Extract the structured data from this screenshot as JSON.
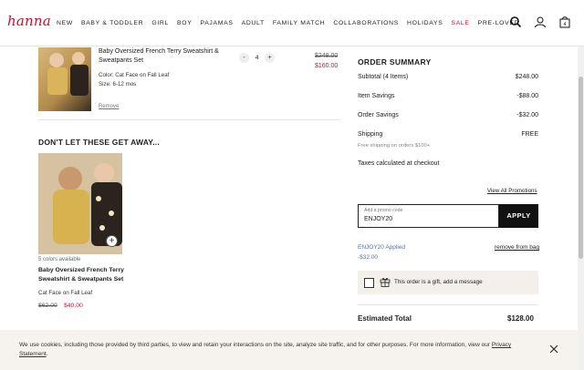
{
  "header": {
    "logo": "hanna",
    "nav": [
      "NEW",
      "BABY & TODDLER",
      "GIRL",
      "BOY",
      "PAJAMAS",
      "ADULT",
      "FAMILY MATCH",
      "COLLABORATIONS",
      "HOLIDAYS",
      "SALE",
      "PRE-LOVED"
    ],
    "cart_count": "4"
  },
  "cart_item": {
    "title": "Baby Oversized French Terry Sweatshirt & Sweatpants Set",
    "color": "Color: Cat Face on Fall Leaf",
    "size": "Size: 6-12 mos",
    "remove_label": "Remove",
    "qty_minus": "-",
    "quantity": "4",
    "qty_plus": "+",
    "old_price": "$248.00",
    "new_price": "$160.00"
  },
  "recommendations": {
    "title": "DON'T LET THESE GET AWAY...",
    "colors": "5 colors available",
    "name": "Baby Oversized French Terry Sweatshirt & Sweatpants Set",
    "color": "Cat Face on Fall Leaf",
    "old_price": "$62.00",
    "new_price": "$40.00"
  },
  "summary": {
    "title": "ORDER SUMMARY",
    "subtotal_label": "Subtotal (4 Items)",
    "subtotal_value": "$248.00",
    "item_savings_label": "Item Savings",
    "item_savings_value": "-$88.00",
    "order_savings_label": "Order Savings",
    "order_savings_value": "-$32.00",
    "shipping_label": "Shipping",
    "shipping_value": "FREE",
    "shipping_note": "Free shipping on orders $100+",
    "taxes": "Taxes calculated at checkout",
    "view_promos": "View All Promotions",
    "promo_placeholder": "Add a promo code",
    "promo_value": "ENJOY20",
    "apply_label": "APPLY",
    "applied_label": "ENJOY20 Applied",
    "applied_amount": "-$32.00",
    "remove_from_bag": "remove from bag",
    "gift_text": "This order is a gift, add a message",
    "estimated_label": "Estimated Total",
    "estimated_value": "$128.00"
  },
  "cookie": {
    "text": "We use cookies, including those provided by third parties, to view and retain your interactions on the site, analyze site traffic, and for other purposes. For more information, view our",
    "link": "Privacy Statement",
    "end": "."
  },
  "colors": {
    "brand": "#c8102e",
    "promo": "#5a6fa8",
    "apply_bg": "#111111"
  }
}
